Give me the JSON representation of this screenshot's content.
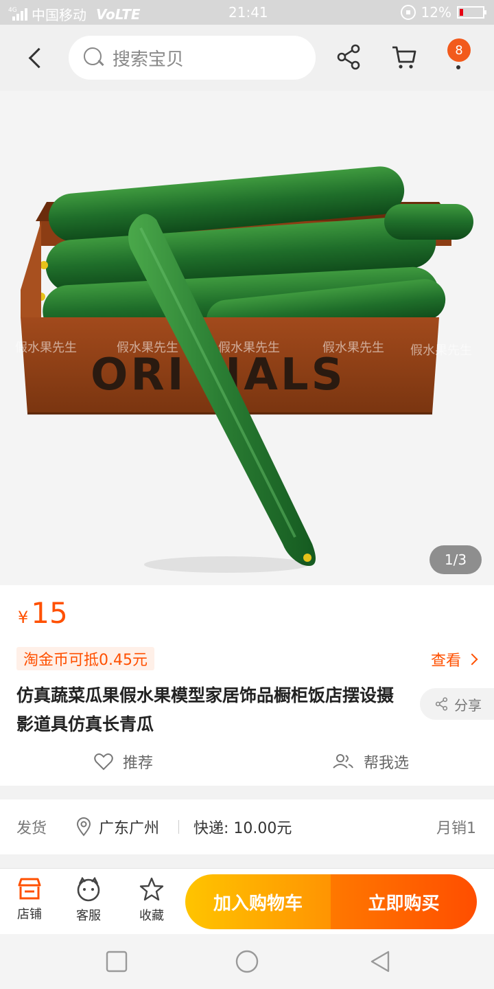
{
  "status_bar": {
    "network": "4G",
    "carrier": "中国移动",
    "volte": "VoLTE",
    "time": "21:41",
    "battery": "12%",
    "battery_color": "#e60012"
  },
  "nav": {
    "search_placeholder": "搜索宝贝",
    "cart_badge": "8",
    "icons": [
      "back-icon",
      "search-icon",
      "share-icon",
      "cart-icon",
      "more-icon"
    ]
  },
  "gallery": {
    "counter": "1/3",
    "crate_text": "ORI  NALS",
    "watermark": "假水果先生"
  },
  "product": {
    "price_symbol": "¥",
    "price": "15",
    "coin_tag": "淘金币可抵0.45元",
    "view_label": "查看",
    "title": "仿真蔬菜瓜果假水果模型家居饰品橱柜饭店摆设摄影道具仿真长青瓜",
    "share_label": "分享",
    "recommend_label": "推荐",
    "help_choose_label": "帮我选",
    "accent_color": "#ff5000"
  },
  "delivery": {
    "label": "发货",
    "location": "广东广州",
    "fee": "快递: 10.00元",
    "monthly_sales": "月销1"
  },
  "bottom_bar": {
    "shop": "店铺",
    "service": "客服",
    "favorite": "收藏",
    "add_to_cart": "加入购物车",
    "buy_now": "立即购买"
  }
}
